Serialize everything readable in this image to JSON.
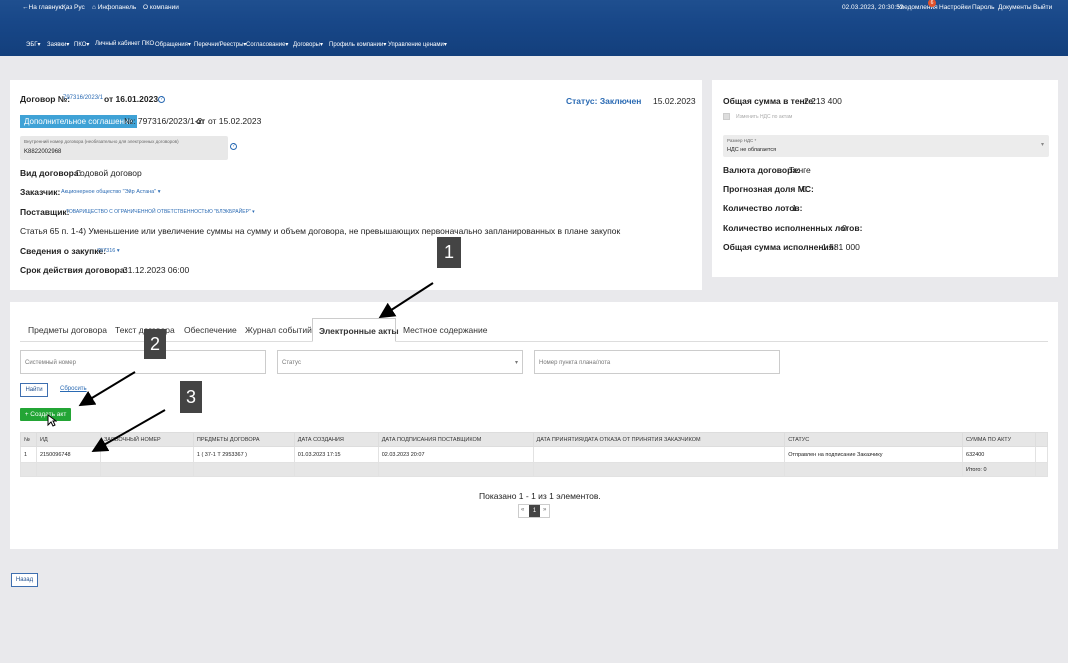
{
  "header": {
    "top_links": [
      "←На главную",
      "Қаз",
      "Рус",
      "⌂ Инфопанель",
      "О компании"
    ],
    "datetime": "02.03.2023, 20:30:52",
    "notifications_label": "Уведомления",
    "notifications_count": "6",
    "right_links": [
      "Настройки",
      "Пароль",
      "Документы",
      "Выйти"
    ],
    "menu": [
      "ЭБГ▾",
      "Заявки▾",
      "ПКО▾",
      "Личный кабинет ПКО",
      "Обращения▾",
      "Перечни/Реестры▾",
      "Согласование▾",
      "Договоры▾",
      "Профиль компании▾",
      "Управление ценами▾"
    ]
  },
  "contract": {
    "number_label": "Договор №:",
    "number_value": "797316/2023/1",
    "date_label": "от 16.01.2023",
    "status": "Статус: Заключен",
    "status_date": "15.02.2023",
    "addendum_button": "Дополнительное соглашение",
    "addendum_text": "№: 797316/2023/1-2",
    "addendum_date": "от 15.02.2023",
    "internal_label": "Внутренний номер договора (необязательно для электронных договоров)",
    "internal_value": "K8822002968",
    "type_label": "Вид договора:",
    "type_value": "Годовой договор",
    "customer_label": "Заказчик:",
    "customer_value": "Акционерное общество \"Эйр Астана\" ▾",
    "supplier_label": "Поставщик:",
    "supplier_value": "ТОВАРИЩЕСТВО С ОГРАНИЧЕННОЙ ОТВЕТСТВЕННОСТЬЮ \"БЛЭКБРАЙЕР\" ▾",
    "article": "Статья 65 п. 1-4) Уменьшение или увеличение суммы на сумму и объем договора, не превышающих первоначально запланированных в плане закупок",
    "procurement_label": "Сведения о закупке:",
    "procurement_value": "797316 ▾",
    "term_label": "Срок действия договора:",
    "term_value": "31.12.2023 06:00"
  },
  "summary": {
    "total_label": "Общая сумма в тенге:",
    "total_value": "2 213 400",
    "vat_change": "Изменить НДС по актам",
    "vat_label": "Размер НДС *",
    "vat_value": "НДС не облагается",
    "currency_label": "Валюта договора:",
    "currency_value": "Тенге",
    "share_label": "Прогнозная доля МС:",
    "share_value": "0",
    "lots_label": "Количество лотов:",
    "lots_value": "1",
    "done_lots_label": "Количество исполненных лотов:",
    "done_lots_value": "0",
    "exec_label": "Общая сумма исполнения:",
    "exec_value": "1 581 000"
  },
  "tabs": [
    "Предметы договора",
    "Текст договора",
    "Обеспечение",
    "Журнал событий",
    "Электронные акты",
    "Местное содержание"
  ],
  "filters": {
    "system_number": "Системный номер",
    "status": "Статус",
    "plan_item": "Номер пункта плана/лота",
    "find": "Найти",
    "reset": "Сбросить",
    "create": "+ Создать акт"
  },
  "table": {
    "headers": [
      "№",
      "ИД",
      "ЗАЯВОЧНЫЙ НОМЕР",
      "ПРЕДМЕТЫ ДОГОВОРА",
      "ДАТА СОЗДАНИЯ",
      "ДАТА ПОДПИСАНИЯ ПОСТАВЩИКОМ",
      "ДАТА ПРИНЯТИЯ/ДАТА ОТКАЗА ОТ ПРИНЯТИЯ ЗАКАЗЧИКОМ",
      "СТАТУС",
      "СУММА ПО АКТУ"
    ],
    "row": [
      "1",
      "2150096748",
      "",
      "1 ( 37-1 Т 2953367 )",
      "01.03.2023 17:15",
      "02.03.2023 20:07",
      "",
      "Отправлен на подписание Заказчику",
      "632400"
    ],
    "total": "Итого: 0"
  },
  "pagination": {
    "info": "Показано 1 - 1 из 1 элементов.",
    "prev": "«",
    "page": "1",
    "next": "»"
  },
  "back_button": "Назад",
  "callouts": [
    "1",
    "2",
    "3"
  ]
}
